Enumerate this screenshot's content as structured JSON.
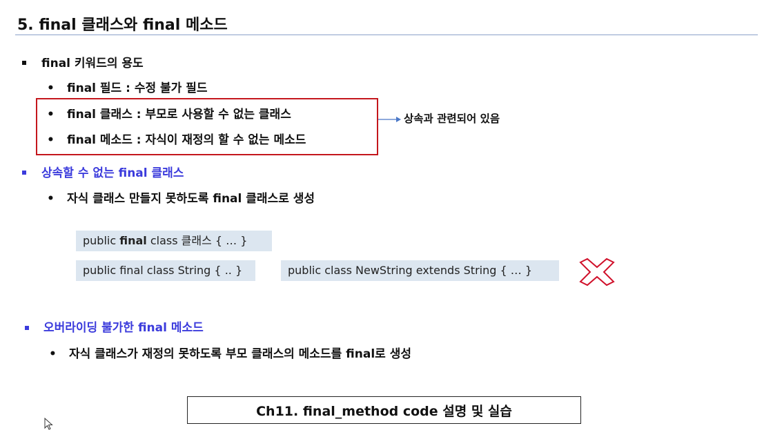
{
  "title": "5. final 클래스와  final 메소드",
  "section1": {
    "heading": "final 키워드의 용도",
    "items": [
      "final 필드 : 수정 불가 필드",
      "final 클래스 : 부모로 사용할 수 없는 클래스",
      "final  메소드 : 자식이 재정의 할 수 없는 메소드"
    ],
    "annotation": "상속과 관련되어 있음"
  },
  "section2": {
    "heading": "상속할 수 없는 final 클래스",
    "item": "자식 클래스 만들지 못하도록  final  클래스로 생성",
    "code1": {
      "prefix": "public ",
      "keyword": "final",
      "suffix": " class  클래스 { … }"
    },
    "code2": "public final class String { .. }",
    "code3": "public class NewString extends String { … }"
  },
  "section3": {
    "heading": "오버라이딩 불가한 final 메소드",
    "item": "자식 클래스가 재정의 못하도록 부모 클래스의 메소드를  final로 생성"
  },
  "footer": "Ch11. final_method code 설명 및 실습",
  "colors": {
    "accent_blue": "#3b3bdc",
    "red_box": "#c4161c",
    "code_bg": "#dce6f0",
    "arrow": "#4a78c8"
  }
}
